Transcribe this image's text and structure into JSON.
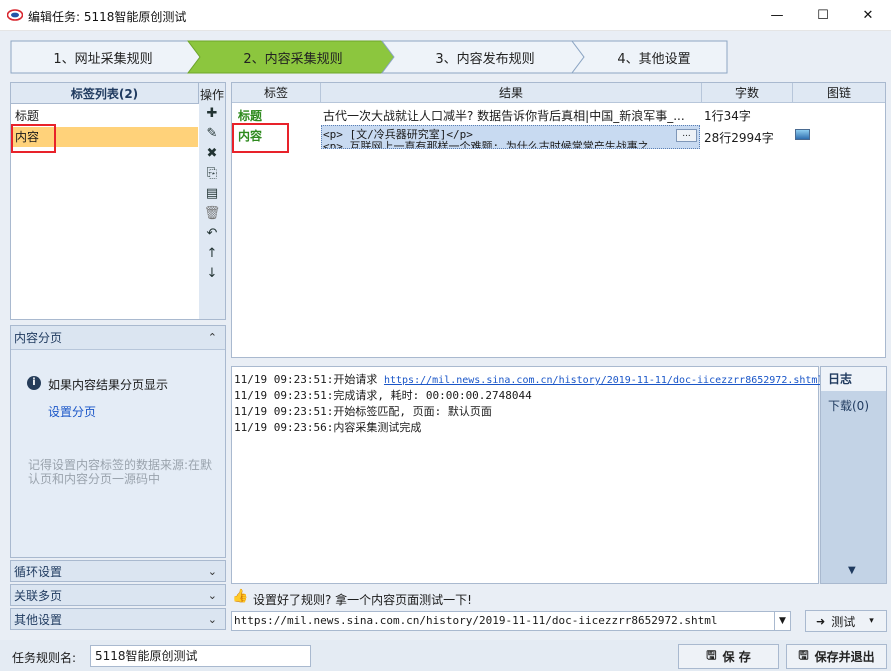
{
  "window": {
    "title": "编辑任务: 5118智能原创测试",
    "minimize_glyph": "—",
    "maximize_glyph": "☐",
    "close_glyph": "✕"
  },
  "steps": [
    {
      "label": "1、网址采集规则",
      "active": false
    },
    {
      "label": "2、内容采集规则",
      "active": true
    },
    {
      "label": "3、内容发布规则",
      "active": false
    },
    {
      "label": "4、其他设置",
      "active": false
    }
  ],
  "tag_list": {
    "header": "标签列表(2)",
    "ops_label": "操作",
    "items": [
      {
        "label": "标题",
        "selected": false
      },
      {
        "label": "内容",
        "selected": true
      }
    ],
    "ops_icons": [
      "add-icon",
      "edit-icon",
      "delete-icon",
      "copy-icon",
      "paste-icon",
      "trash-icon",
      "undo-icon",
      "move-up-icon",
      "move-down-icon"
    ]
  },
  "pagination": {
    "header": "内容分页",
    "info_text": "如果内容结果分页显示",
    "link": "设置分页",
    "hint": "记得设置内容标签的数据来源:在默认页和内容分页一源码中"
  },
  "accordion": [
    {
      "label": "循环设置"
    },
    {
      "label": "关联多页"
    },
    {
      "label": "其他设置"
    }
  ],
  "grid": {
    "columns": [
      "标签",
      "结果",
      "字数",
      "图链"
    ],
    "rows": [
      {
        "tag": "标题",
        "result": "古代一次大战就让人口减半? 数据告诉你背后真相|中国_新浪军事_...",
        "count": "1行34字",
        "has_image": false
      },
      {
        "tag": "内容",
        "result_line1": "<p> [文/冷兵器研究室]</p>",
        "result_line2": "<p> 互联网上一直有那样一个难题: 为什么古时候常常产生战事之",
        "count": "28行2994字",
        "has_image": true
      }
    ],
    "ellipsis_button": "..."
  },
  "log": {
    "lines": [
      {
        "prefix": "11/19 09:23:51:开始请求 ",
        "url": "https://mil.news.sina.com.cn/history/2019-11-11/doc-iicezzrr8652972.shtml"
      },
      {
        "prefix": "11/19 09:23:51:完成请求, 耗时: 00:00:00.2748044",
        "url": ""
      },
      {
        "prefix": "11/19 09:23:51:开始标签匹配, 页面: 默认页面",
        "url": ""
      },
      {
        "prefix": "11/19 09:23:56:内容采集测试完成",
        "url": ""
      }
    ],
    "tabs": [
      {
        "label": "日志",
        "active": true
      },
      {
        "label": "下载(0)",
        "active": false
      }
    ]
  },
  "hint": "设置好了规则? 拿一个内容页面测试一下!",
  "url_input": "https://mil.news.sina.com.cn/history/2019-11-11/doc-iicezzrr8652972.shtml",
  "test_button": "测试",
  "bottom": {
    "task_name_label": "任务规则名:",
    "task_name_value": "5118智能原创测试",
    "save": "保 存",
    "save_exit": "保存并退出"
  },
  "colors": {
    "active_step": "#8cc63e",
    "selected_row": "#ffd27a",
    "tag_green": "#2e8a1e",
    "highlight": "#e8222a",
    "link": "#1a56c8"
  }
}
